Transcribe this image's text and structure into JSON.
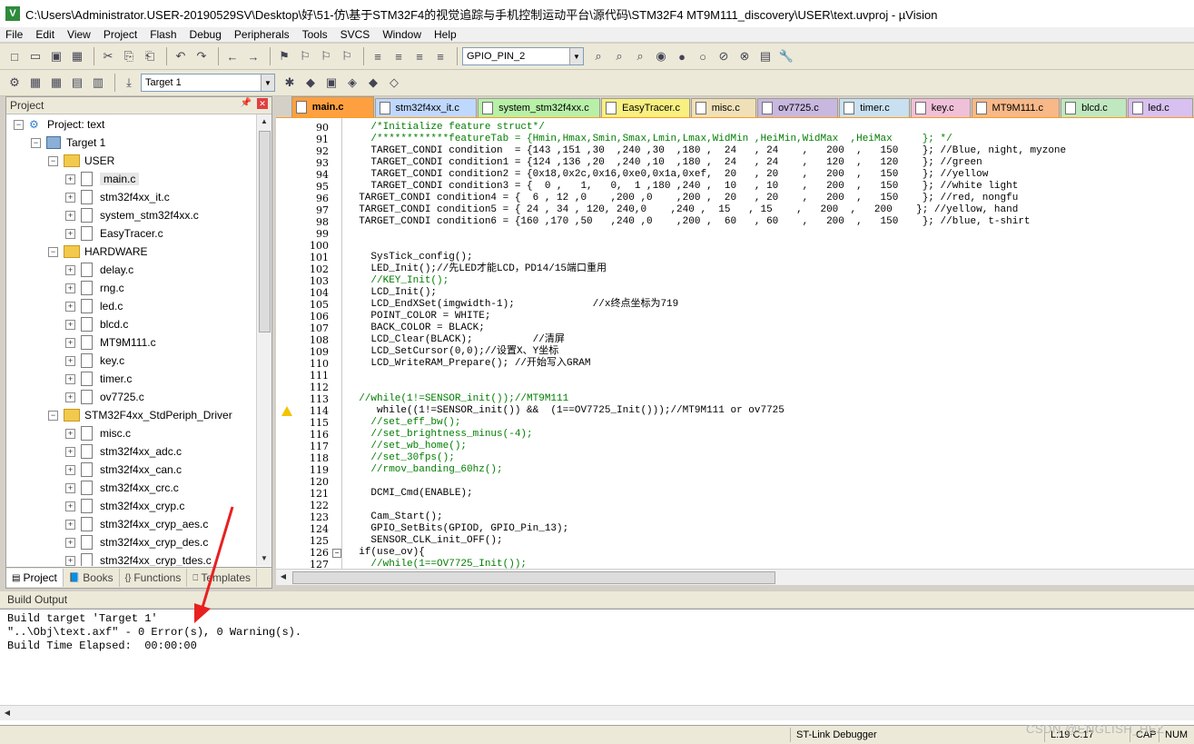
{
  "title_bar": {
    "app_icon": "uvision-logo-icon",
    "title": "C:\\Users\\Administrator.USER-20190529SV\\Desktop\\好\\51-仿\\基于STM32F4的视觉追踪与手机控制运动平台\\源代码\\STM32F4 MT9M111_discovery\\USER\\text.uvproj - µVision"
  },
  "menu": [
    "File",
    "Edit",
    "View",
    "Project",
    "Flash",
    "Debug",
    "Peripherals",
    "Tools",
    "SVCS",
    "Window",
    "Help"
  ],
  "toolbar1": {
    "find_combo_value": "GPIO_PIN_2",
    "icons": [
      "new-file-icon",
      "open-file-icon",
      "save-icon",
      "save-all-icon",
      "cut-icon",
      "copy-icon",
      "paste-icon",
      "undo-icon",
      "redo-icon",
      "nav-back-icon",
      "nav-forward-icon",
      "bookmark-icon",
      "prev-bookmark-icon",
      "next-bookmark-icon",
      "clear-bookmarks-icon",
      "indent-icon",
      "unindent-icon",
      "comment-icon",
      "uncomment-icon",
      "find-in-files-icon",
      "find-icon",
      "incremental-find-icon",
      "debug-session-icon",
      "breakpoint-icon",
      "disable-breakpoint-icon",
      "kill-breakpoints-icon",
      "kill-all-breakpoints-icon",
      "window-layout-icon",
      "configure-icon"
    ]
  },
  "toolbar2": {
    "target_combo_value": "Target 1",
    "icons": [
      "translate-icon",
      "build-icon",
      "rebuild-icon",
      "batch-build-icon",
      "stop-build-icon",
      "download-icon",
      "target-options-icon",
      "manage-components-icon",
      "select-packs-icon",
      "manage-packs-icon",
      "pack-installer-icon",
      "rte-icon"
    ]
  },
  "project_panel": {
    "header": "Project",
    "tree": [
      {
        "label": "Project: text",
        "level": 0,
        "type": "project",
        "expander": "−"
      },
      {
        "label": "Target 1",
        "level": 1,
        "type": "target",
        "expander": "−"
      },
      {
        "label": "USER",
        "level": 2,
        "type": "folder",
        "expander": "−"
      },
      {
        "label": "main.c",
        "level": 3,
        "type": "file",
        "expander": "+",
        "selected": true
      },
      {
        "label": "stm32f4xx_it.c",
        "level": 3,
        "type": "file",
        "expander": "+"
      },
      {
        "label": "system_stm32f4xx.c",
        "level": 3,
        "type": "file",
        "expander": "+"
      },
      {
        "label": "EasyTracer.c",
        "level": 3,
        "type": "file",
        "expander": "+"
      },
      {
        "label": "HARDWARE",
        "level": 2,
        "type": "folder",
        "expander": "−"
      },
      {
        "label": "delay.c",
        "level": 3,
        "type": "file",
        "expander": "+"
      },
      {
        "label": "rng.c",
        "level": 3,
        "type": "file",
        "expander": "+"
      },
      {
        "label": "led.c",
        "level": 3,
        "type": "file",
        "expander": "+"
      },
      {
        "label": "blcd.c",
        "level": 3,
        "type": "file",
        "expander": "+"
      },
      {
        "label": "MT9M111.c",
        "level": 3,
        "type": "file",
        "expander": "+"
      },
      {
        "label": "key.c",
        "level": 3,
        "type": "file",
        "expander": "+"
      },
      {
        "label": "timer.c",
        "level": 3,
        "type": "file",
        "expander": "+"
      },
      {
        "label": "ov7725.c",
        "level": 3,
        "type": "file",
        "expander": "+"
      },
      {
        "label": "STM32F4xx_StdPeriph_Driver",
        "level": 2,
        "type": "folder",
        "expander": "−"
      },
      {
        "label": "misc.c",
        "level": 3,
        "type": "file",
        "expander": "+"
      },
      {
        "label": "stm32f4xx_adc.c",
        "level": 3,
        "type": "file",
        "expander": "+"
      },
      {
        "label": "stm32f4xx_can.c",
        "level": 3,
        "type": "file",
        "expander": "+"
      },
      {
        "label": "stm32f4xx_crc.c",
        "level": 3,
        "type": "file",
        "expander": "+"
      },
      {
        "label": "stm32f4xx_cryp.c",
        "level": 3,
        "type": "file",
        "expander": "+"
      },
      {
        "label": "stm32f4xx_cryp_aes.c",
        "level": 3,
        "type": "file",
        "expander": "+"
      },
      {
        "label": "stm32f4xx_cryp_des.c",
        "level": 3,
        "type": "file",
        "expander": "+"
      },
      {
        "label": "stm32f4xx_cryp_tdes.c",
        "level": 3,
        "type": "file",
        "expander": "+"
      }
    ],
    "bottom_tabs": [
      {
        "label": "Project",
        "icon": "project-tab-icon",
        "active": true
      },
      {
        "label": "Books",
        "icon": "books-tab-icon",
        "active": false
      },
      {
        "label": "Functions",
        "icon": "functions-tab-icon",
        "active": false
      },
      {
        "label": "Templates",
        "icon": "templates-tab-icon",
        "active": false
      }
    ]
  },
  "file_tabs": [
    {
      "label": "main.c",
      "color": "#ffa040",
      "active": true
    },
    {
      "label": "stm32f4xx_it.c",
      "color": "#bfd8ff"
    },
    {
      "label": "system_stm32f4xx.c",
      "color": "#b8f0a8"
    },
    {
      "label": "EasyTracer.c",
      "color": "#f8f080"
    },
    {
      "label": "misc.c",
      "color": "#f0e0b8"
    },
    {
      "label": "ov7725.c",
      "color": "#c8b8e0"
    },
    {
      "label": "timer.c",
      "color": "#c8e0f0"
    },
    {
      "label": "key.c",
      "color": "#f0c0d8"
    },
    {
      "label": "MT9M111.c",
      "color": "#f8b888"
    },
    {
      "label": "blcd.c",
      "color": "#c0e8c0"
    },
    {
      "label": "led.c",
      "color": "#d8c0f0"
    }
  ],
  "code_lines": [
    {
      "n": "90",
      "text": "    /*Initialize feature struct*/",
      "kind": "comment"
    },
    {
      "n": "91",
      "text": "    /************featureTab = {Hmin,Hmax,Smin,Smax,Lmin,Lmax,WidMin ,HeiMin,WidMax  ,HeiMax     }; */",
      "kind": "comment"
    },
    {
      "n": "92",
      "text": "    TARGET_CONDI condition  = {143 ,151 ,30  ,240 ,30  ,180 ,  24   , 24    ,   200  ,   150    }; //Blue, night, myzone",
      "kind": "code"
    },
    {
      "n": "93",
      "text": "    TARGET_CONDI condition1 = {124 ,136 ,20  ,240 ,10  ,180 ,  24   , 24    ,   120  ,   120    }; //green",
      "kind": "code"
    },
    {
      "n": "94",
      "text": "    TARGET_CONDI condition2 = {0x18,0x2c,0x16,0xe0,0x1a,0xef,  20   , 20    ,   200  ,   150    }; //yellow",
      "kind": "code"
    },
    {
      "n": "95",
      "text": "    TARGET_CONDI condition3 = {  0 ,   1,   0,  1 ,180 ,240 ,  10   , 10    ,   200  ,   150    }; //white light",
      "kind": "code"
    },
    {
      "n": "96",
      "text": "  TARGET_CONDI condition4 = {  6 , 12 ,0    ,200 ,0    ,200 ,  20   , 20    ,   200  ,   150    }; //red, nongfu",
      "kind": "code"
    },
    {
      "n": "97",
      "text": "  TARGET_CONDI condition5 = { 24 , 34 , 120, 240,0    ,240 ,  15   , 15    ,   200  ,   200    }; //yellow, hand",
      "kind": "code"
    },
    {
      "n": "98",
      "text": "  TARGET_CONDI condition6 = {160 ,170 ,50   ,240 ,0    ,200 ,  60   , 60    ,   200  ,   150    }; //blue, t-shirt",
      "kind": "code"
    },
    {
      "n": "99",
      "text": "",
      "kind": "code"
    },
    {
      "n": "100",
      "text": "",
      "kind": "code"
    },
    {
      "n": "101",
      "text": "    SysTick_config();",
      "kind": "code"
    },
    {
      "n": "102",
      "text": "    LED_Init();//先LED才能LCD，PD14/15端口重用",
      "kind": "code"
    },
    {
      "n": "103",
      "text": "    //KEY_Init();",
      "kind": "comment"
    },
    {
      "n": "104",
      "text": "    LCD_Init();",
      "kind": "code"
    },
    {
      "n": "105",
      "text": "    LCD_EndXSet(imgwidth-1);             //x终点坐标为719",
      "kind": "code"
    },
    {
      "n": "106",
      "text": "    POINT_COLOR = WHITE;",
      "kind": "code"
    },
    {
      "n": "107",
      "text": "    BACK_COLOR = BLACK;",
      "kind": "code"
    },
    {
      "n": "108",
      "text": "    LCD_Clear(BLACK);          //清屏",
      "kind": "code"
    },
    {
      "n": "109",
      "text": "    LCD_SetCursor(0,0);//设置X、Y坐标",
      "kind": "code"
    },
    {
      "n": "110",
      "text": "    LCD_WriteRAM_Prepare(); //开始写入GRAM",
      "kind": "code"
    },
    {
      "n": "111",
      "text": "",
      "kind": "code"
    },
    {
      "n": "112",
      "text": "",
      "kind": "code"
    },
    {
      "n": "113",
      "text": "  //while(1!=SENSOR_init());//MT9M111",
      "kind": "comment"
    },
    {
      "n": "114",
      "text": "     while((1!=SENSOR_init()) &&  (1==OV7725_Init()));//MT9M111 or ov7725",
      "kind": "code",
      "warning": true
    },
    {
      "n": "115",
      "text": "    //set_eff_bw();",
      "kind": "comment"
    },
    {
      "n": "116",
      "text": "    //set_brightness_minus(-4);",
      "kind": "comment"
    },
    {
      "n": "117",
      "text": "    //set_wb_home();",
      "kind": "comment"
    },
    {
      "n": "118",
      "text": "    //set_30fps();",
      "kind": "comment"
    },
    {
      "n": "119",
      "text": "    //rmov_banding_60hz();",
      "kind": "comment"
    },
    {
      "n": "120",
      "text": "",
      "kind": "code"
    },
    {
      "n": "121",
      "text": "    DCMI_Cmd(ENABLE);",
      "kind": "code"
    },
    {
      "n": "122",
      "text": "",
      "kind": "code"
    },
    {
      "n": "123",
      "text": "    Cam_Start();",
      "kind": "code"
    },
    {
      "n": "124",
      "text": "    GPIO_SetBits(GPIOD, GPIO_Pin_13);",
      "kind": "code"
    },
    {
      "n": "125",
      "text": "    SENSOR_CLK_init_OFF();",
      "kind": "code"
    },
    {
      "n": "126",
      "text": "  if(use_ov){",
      "kind": "code",
      "fold": true
    },
    {
      "n": "127",
      "text": "    //while(1==OV7725_Init());",
      "kind": "comment"
    }
  ],
  "build_output": {
    "header": "Build Output",
    "lines": [
      "Build target 'Target 1'",
      "\"..\\Obj\\text.axf\" - 0 Error(s), 0 Warning(s).",
      "Build Time Elapsed:  00:00:00"
    ]
  },
  "status_bar": {
    "debugger": "ST-Link Debugger",
    "position": "L:19 C:17",
    "caps": "CAP",
    "num": "NUM"
  },
  "watermark": "CSDN @ENGLISH_HEZ",
  "colors": {
    "annotation_arrow": "#e82020",
    "active_tab_border": "#ff9a1a",
    "comment_green": "#007d00"
  }
}
